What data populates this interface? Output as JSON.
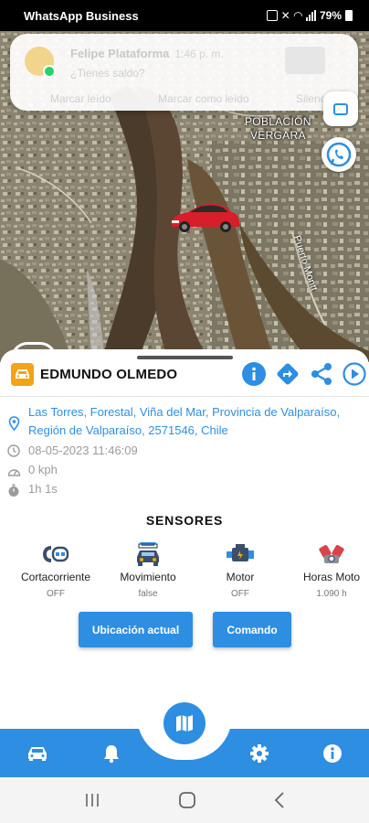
{
  "status_bar": {
    "app_name": "WhatsApp Business",
    "battery": "79%"
  },
  "notification": {
    "sender": "Felipe Plataforma",
    "time": "1:46 p. m.",
    "message": "¿Tienes saldo?",
    "actions": [
      "Marcar leído",
      "Marcar como leído",
      "Silenciar"
    ]
  },
  "map": {
    "place_label": "POBLACIÓN\nVERGARA",
    "road_label": "Puerto Montt"
  },
  "vehicle": {
    "name": "EDMUNDO OLMEDO",
    "address_line1": "Las Torres, Forestal, Viña del Mar, Provincia de Valparaíso,",
    "address_line2": "Región de Valparaíso, 2571546, Chile",
    "datetime": "08-05-2023 11:46:09",
    "speed": "0 kph",
    "duration": "1h 1s"
  },
  "sensors": {
    "title": "SENSORES",
    "items": [
      {
        "name": "Cortacorriente",
        "value": "OFF",
        "icon": "key-plug-icon"
      },
      {
        "name": "Movimiento",
        "value": "false",
        "icon": "moving-car-icon"
      },
      {
        "name": "Motor",
        "value": "OFF",
        "icon": "engine-icon"
      },
      {
        "name": "Horas Moto",
        "value": "1.090 h",
        "icon": "engine-hours-icon"
      }
    ]
  },
  "buttons": {
    "location": "Ubicación actual",
    "command": "Comando"
  },
  "colors": {
    "primary": "#2d8ee2",
    "badge": "#f3a316",
    "address": "#2f8fe0",
    "whatsapp": "#25d366"
  }
}
